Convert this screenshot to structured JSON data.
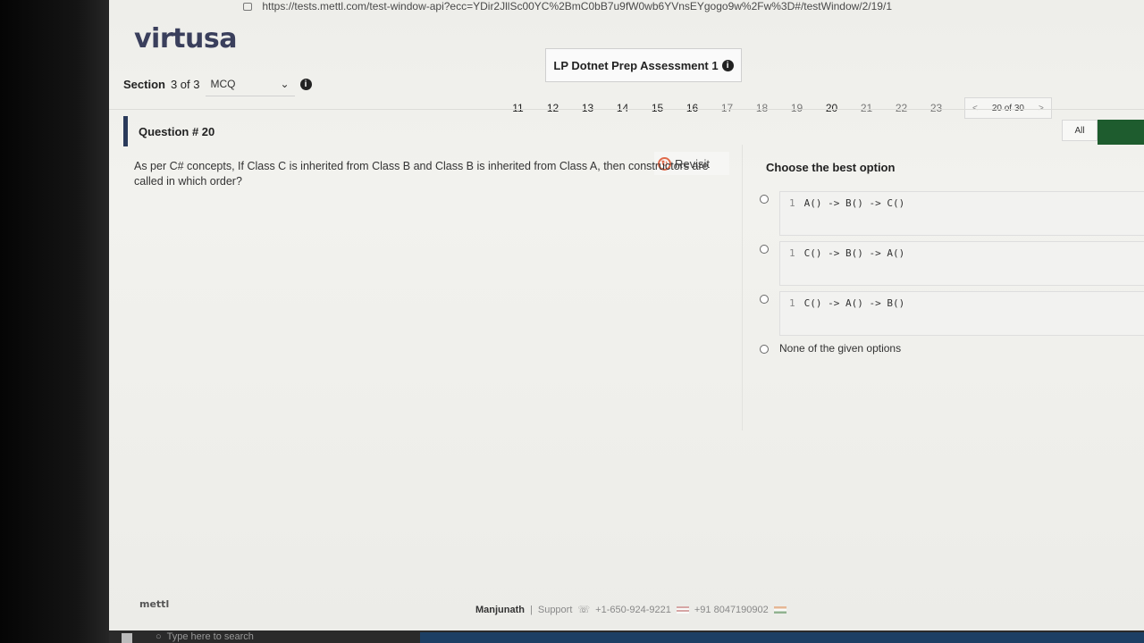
{
  "browser": {
    "url": "https://tests.mettl.com/test-window-api?ecc=YDir2JllSc00YC%2BmC0bB7u9fW0wb6YVnsEYgogo9w%2Fw%3D#/testWindow/2/19/1"
  },
  "header": {
    "logo": "virtusa",
    "assessment_title": "LP Dotnet Prep Assessment 1",
    "info_icon": "info-icon"
  },
  "section": {
    "label": "Section",
    "current": "3 of 3",
    "selected": "MCQ"
  },
  "question_nav": {
    "numbers": [
      "11",
      "12",
      "13",
      "14",
      "15",
      "16",
      "17",
      "18",
      "19",
      "20",
      "21",
      "22",
      "23"
    ],
    "current": "20",
    "prev": "<",
    "position": "20 of 30",
    "next": ">",
    "all_label": "All"
  },
  "question": {
    "label": "Question # 20",
    "text": "As per C# concepts, If Class C is inherited from Class B and Class B is inherited from Class A, then constructors are called in which order?",
    "revisit_label": "Revisit"
  },
  "options": {
    "title": "Choose the best option",
    "items": [
      {
        "line": "1",
        "code": "A() -> B() -> C()"
      },
      {
        "line": "1",
        "code": "C() -> B() -> A()"
      },
      {
        "line": "1",
        "code": "C() -> A() -> B()"
      }
    ],
    "none_label": "None of the given options"
  },
  "footer": {
    "logo": "mettl",
    "user": "Manjunath",
    "support_label": "Support",
    "phone_us": "+1-650-924-9221",
    "phone_in": "+91 8047190902"
  },
  "taskbar": {
    "search_placeholder": "Type here to search"
  }
}
